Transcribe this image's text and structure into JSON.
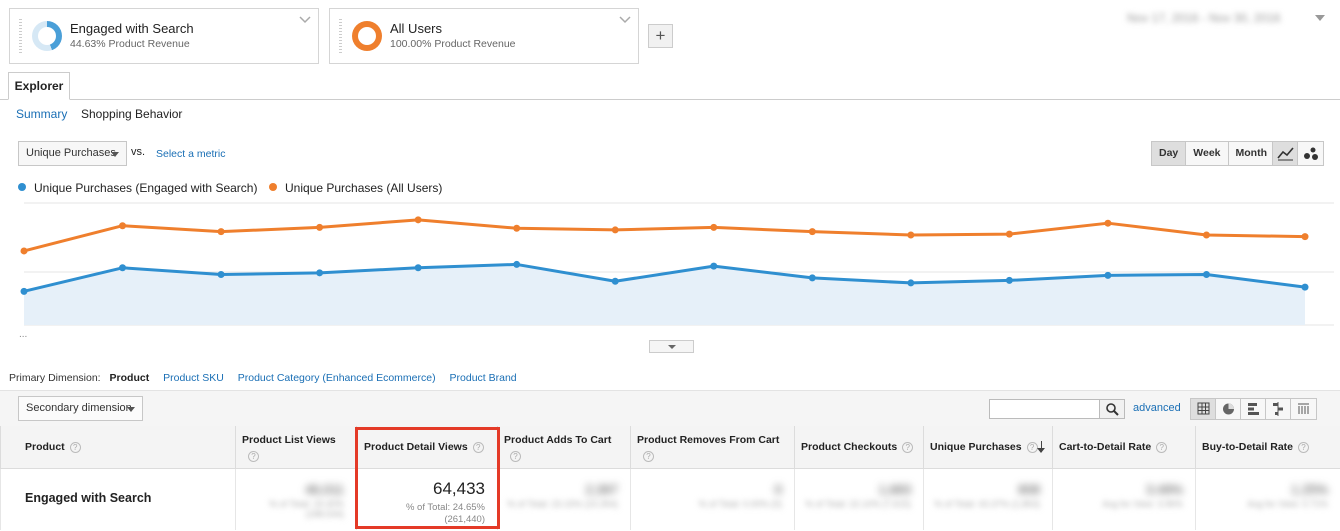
{
  "segments": [
    {
      "name": "Engaged with Search",
      "subtitle": "44.63% Product Revenue",
      "ring_color": "#4a9fd8",
      "ring_fill_pct": 44.63
    },
    {
      "name": "All Users",
      "subtitle": "100.00% Product Revenue",
      "ring_color": "#ef7f2d",
      "ring_fill_pct": 100
    }
  ],
  "add_segment_label": "+",
  "date_range": "Nov 17, 2016 - Nov 30, 2016",
  "tabs": {
    "explorer": "Explorer"
  },
  "subtabs": [
    {
      "label": "Summary",
      "active": true
    },
    {
      "label": "Shopping Behavior",
      "active": false
    }
  ],
  "metric_selector": {
    "value": "Unique Purchases",
    "vs_label": "vs.",
    "select_metric": "Select a metric"
  },
  "granularity": {
    "day": "Day",
    "week": "Week",
    "month": "Month",
    "active": "Day"
  },
  "chart_type_icons": [
    "line-chart-icon",
    "motion-chart-icon"
  ],
  "chart_data": {
    "type": "line",
    "y_top_label": "",
    "y_mid_label": "",
    "x_labels": [
      "",
      "",
      "",
      "",
      "",
      "",
      "",
      "",
      "",
      "",
      "",
      "",
      ""
    ],
    "series": [
      {
        "name": "Unique Purchases (Engaged with Search)",
        "color": "#2f8fd0",
        "values": [
          40,
          68,
          60,
          62,
          68,
          72,
          52,
          70,
          56,
          50,
          53,
          59,
          60,
          45
        ]
      },
      {
        "name": "Unique Purchases (All Users)",
        "color": "#ef7f2d",
        "values": [
          88,
          118,
          111,
          116,
          125,
          115,
          113,
          116,
          111,
          107,
          108,
          121,
          107,
          105
        ]
      }
    ],
    "ylim": [
      0,
      145
    ],
    "area_series": 0
  },
  "primary_dimension": {
    "label": "Primary Dimension:",
    "current": "Product",
    "options": [
      "Product SKU",
      "Product Category (Enhanced Ecommerce)",
      "Product Brand"
    ]
  },
  "secondary_dimension": "Secondary dimension",
  "search": {
    "placeholder": ""
  },
  "advanced_label": "advanced",
  "view_icons": [
    "data-table-icon",
    "pie-chart-icon",
    "performance-icon",
    "comparison-icon",
    "pivot-icon"
  ],
  "table": {
    "headers": [
      {
        "label": "Product"
      },
      {
        "label": "Product List Views"
      },
      {
        "label": "Product Detail Views"
      },
      {
        "label": "Product Adds To Cart"
      },
      {
        "label": "Product Removes From Cart"
      },
      {
        "label": "Product Checkouts"
      },
      {
        "label": "Unique Purchases"
      },
      {
        "label": "Cart-to-Detail Rate"
      },
      {
        "label": "Buy-to-Detail Rate"
      }
    ],
    "row": {
      "label": "Engaged with Search",
      "product_list_views": "46,011",
      "product_list_views_sub": "% of Total: 24.40% (188,534)",
      "product_detail_views": "64,433",
      "product_detail_views_pct": "% of Total: 24.65%",
      "product_detail_views_total": "(261,440)",
      "adds_to_cart": "2,397",
      "adds_to_cart_sub": "% of Total: 23.15% (10,354)",
      "removes_from_cart": "0",
      "removes_from_cart_sub": "% of Total: 0.00% (0)",
      "checkouts": "1,683",
      "checkouts_sub": "% of Total: 22.10% (7,615)",
      "unique_purchases": "808",
      "unique_purchases_sub": "% of Total: 43.37% (1,863)",
      "cart_to_detail": "3.49%",
      "cart_to_detail_sub": "Avg for View: 3.96%",
      "buy_to_detail": "1.25%",
      "buy_to_detail_sub": "Avg for View: 0.71%"
    }
  }
}
